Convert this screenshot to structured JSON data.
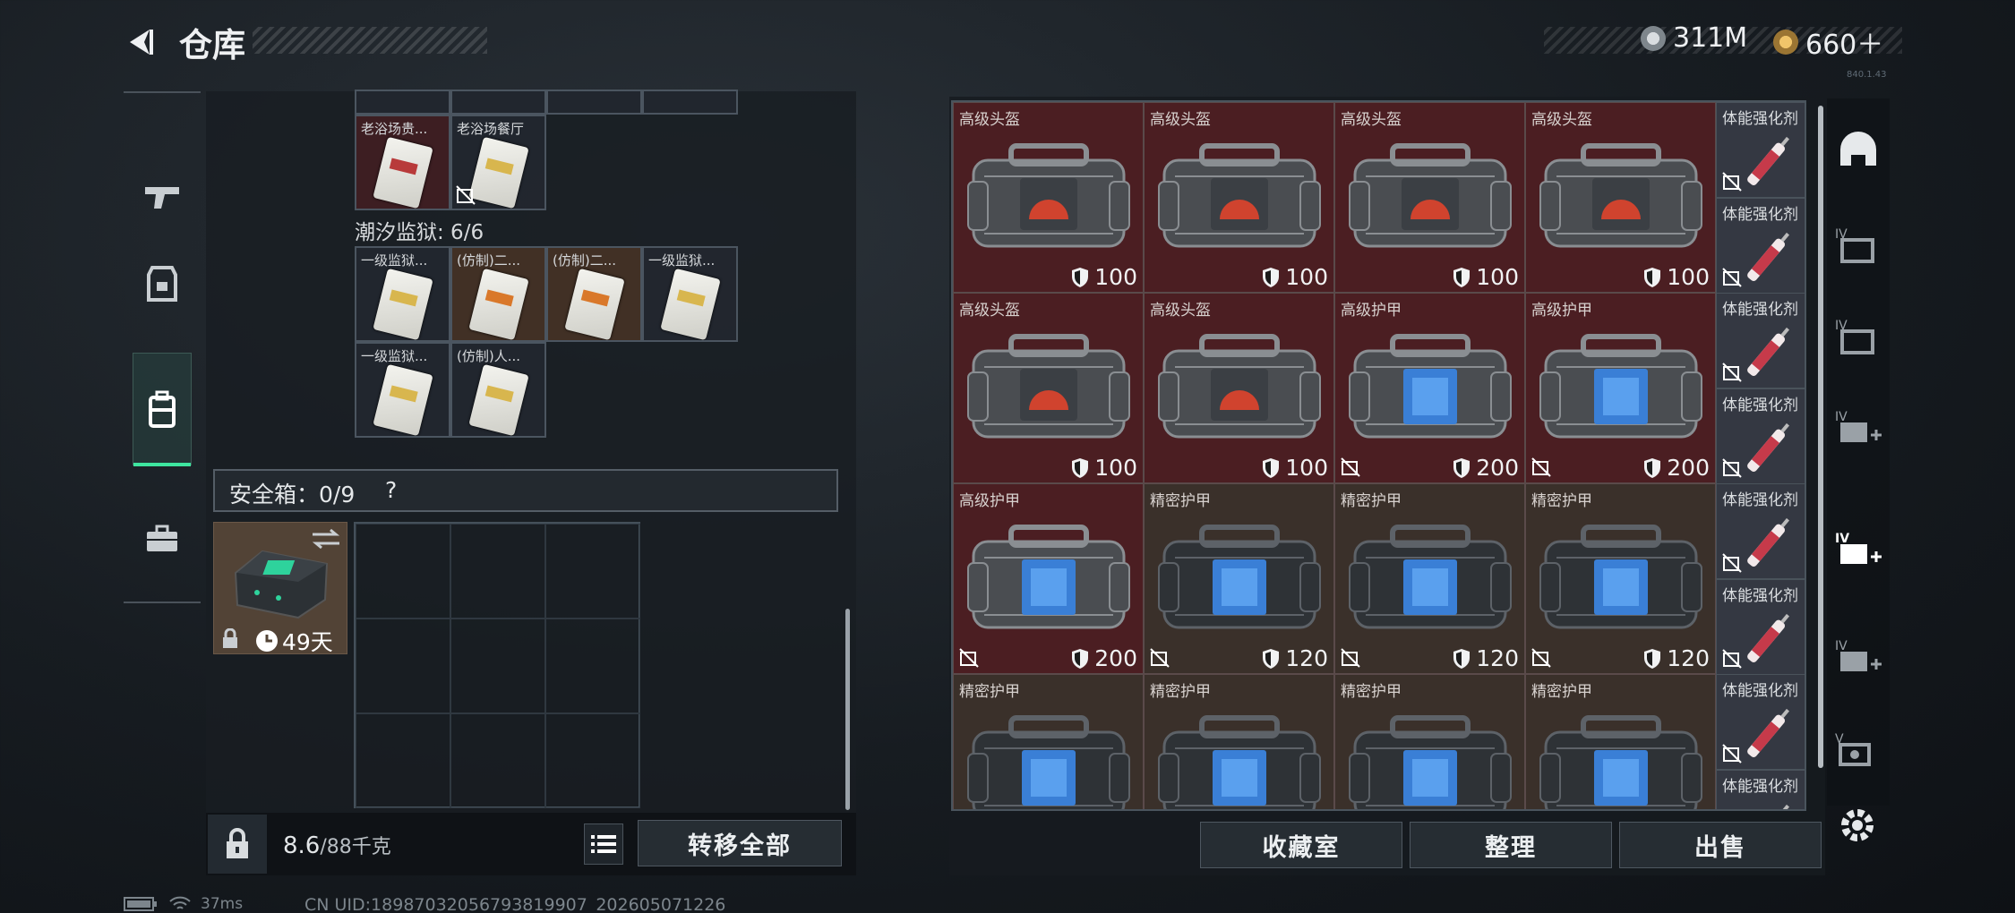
{
  "header": {
    "title": "仓库",
    "currency1": "311M",
    "currency2": "660＋",
    "serial": "840.1.43"
  },
  "left_nav": [
    {
      "name": "weapons-tab"
    },
    {
      "name": "equipment-tab"
    },
    {
      "name": "warehouse-tab",
      "active": true
    },
    {
      "name": "briefcase-tab"
    }
  ],
  "top_cells": [
    "老浴场贵...",
    "老浴场餐厅"
  ],
  "prison": {
    "label": "潮汐监狱: 6/6",
    "cells": [
      "一级监狱...",
      "(仿制)二...",
      "(仿制)二...",
      "一级监狱...",
      "一级监狱...",
      "(仿制)人..."
    ]
  },
  "safe": {
    "label": "安全箱：0/9",
    "help": "?",
    "timer": "49天"
  },
  "footer": {
    "weight_value": "8.6",
    "weight_total": "/88千克",
    "transfer_all": "转移全部"
  },
  "right_grid": {
    "cells": [
      {
        "label": "高级头盔",
        "value": "100",
        "color": "red",
        "kind": "helmet"
      },
      {
        "label": "高级头盔",
        "value": "100",
        "color": "red",
        "kind": "helmet"
      },
      {
        "label": "高级头盔",
        "value": "100",
        "color": "red",
        "kind": "helmet"
      },
      {
        "label": "高级头盔",
        "value": "100",
        "color": "red",
        "kind": "helmet"
      },
      {
        "label": "高级头盔",
        "value": "100",
        "color": "red",
        "kind": "helmet"
      },
      {
        "label": "高级头盔",
        "value": "100",
        "color": "red",
        "kind": "helmet"
      },
      {
        "label": "高级护甲",
        "value": "200",
        "color": "red",
        "kind": "armor-blue"
      },
      {
        "label": "高级护甲",
        "value": "200",
        "color": "red",
        "kind": "armor-blue"
      },
      {
        "label": "高级护甲",
        "value": "200",
        "color": "red",
        "kind": "armor-blue"
      },
      {
        "label": "精密护甲",
        "value": "120",
        "color": "brn",
        "kind": "armor-dark"
      },
      {
        "label": "精密护甲",
        "value": "120",
        "color": "brn",
        "kind": "armor-dark"
      },
      {
        "label": "精密护甲",
        "value": "120",
        "color": "brn",
        "kind": "armor-dark"
      },
      {
        "label": "精密护甲",
        "value": "",
        "color": "brn",
        "kind": "armor-dark"
      },
      {
        "label": "精密护甲",
        "value": "",
        "color": "brn",
        "kind": "armor-dark"
      },
      {
        "label": "精密护甲",
        "value": "",
        "color": "brn",
        "kind": "armor-dark"
      },
      {
        "label": "精密护甲",
        "value": "",
        "color": "brn",
        "kind": "armor-dark"
      }
    ],
    "side_items": [
      "体能强化剂",
      "体能强化剂",
      "体能强化剂",
      "体能强化剂",
      "体能强化剂",
      "体能强化剂",
      "体能强化剂",
      "体能强化剂"
    ]
  },
  "bottom_buttons": {
    "collection": "收藏室",
    "sort": "整理",
    "sell": "出售"
  },
  "status": {
    "ping": "37ms",
    "uid": "CN UID:18987032056793819907_202605071226"
  },
  "colors": {
    "accent": "#3ee6a0",
    "red_cell": "#4b1e22",
    "brown_cell": "#3a302a"
  }
}
